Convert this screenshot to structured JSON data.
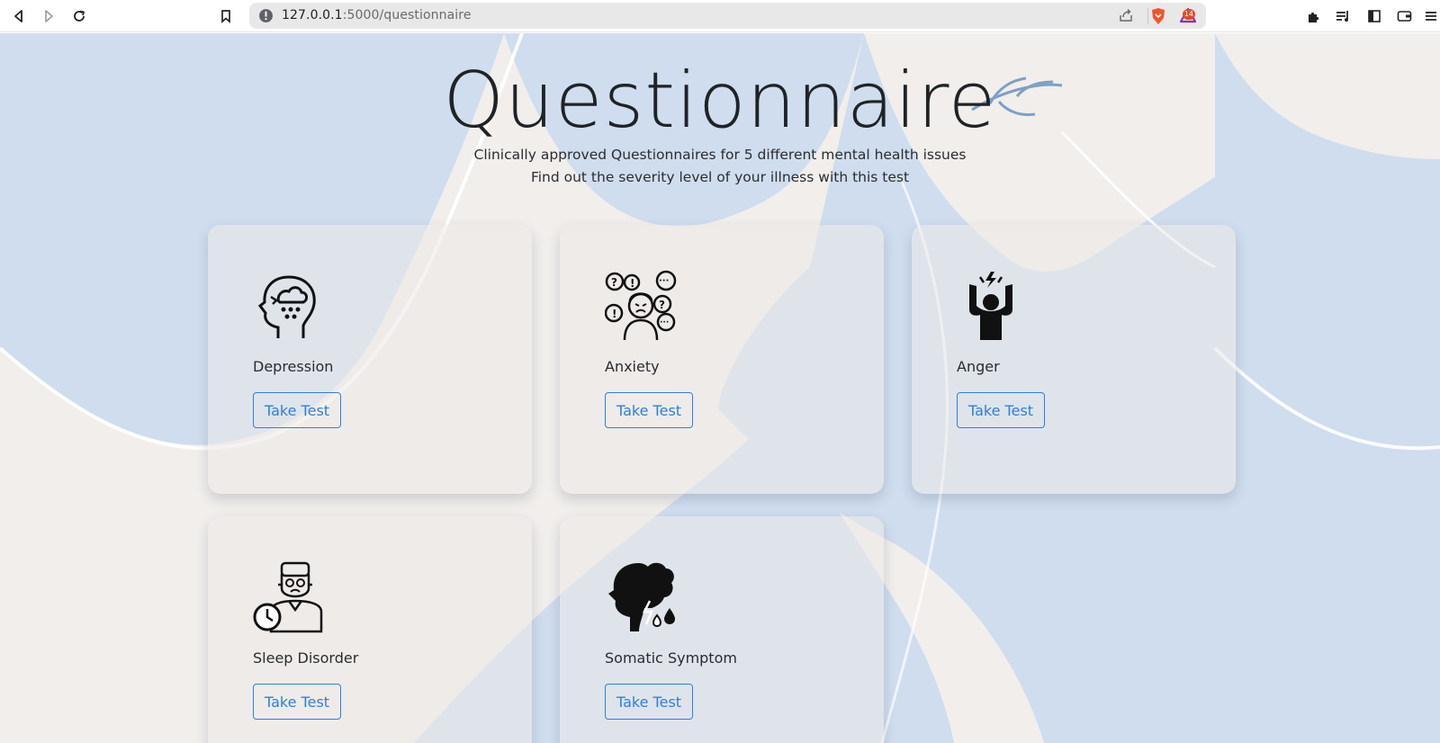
{
  "browser": {
    "url_host": "127.0.0.1",
    "url_path": ":5000/questionnaire",
    "rewards_badge": "14",
    "icons": [
      "back-icon",
      "forward-icon",
      "reload-icon",
      "bookmark-icon",
      "site-info-icon",
      "share-icon",
      "brave-shield-icon",
      "brave-rewards-icon",
      "extensions-icon",
      "playlist-icon",
      "sidebar-icon",
      "wallet-icon",
      "menu-icon"
    ]
  },
  "page": {
    "title": "Questionnaire",
    "subtitle_line1": "Clinically approved Questionnaires for 5 different mental health issues",
    "subtitle_line2": "Find out the severity level of your illness with this test"
  },
  "cards": [
    {
      "label": "Depression",
      "button": "Take Test",
      "icon": "depression-head-icon"
    },
    {
      "label": "Anxiety",
      "button": "Take Test",
      "icon": "anxiety-person-icon"
    },
    {
      "label": "Anger",
      "button": "Take Test",
      "icon": "anger-person-icon"
    },
    {
      "label": "Sleep Disorder",
      "button": "Take Test",
      "icon": "sleep-disorder-person-icon"
    },
    {
      "label": "Somatic Symptom",
      "button": "Take Test",
      "icon": "somatic-head-icon"
    }
  ],
  "colors": {
    "page_bg": "#f1eeec",
    "blue_shape": "#cfddef",
    "button_blue": "#2f7ee0",
    "title_text": "#202326"
  }
}
